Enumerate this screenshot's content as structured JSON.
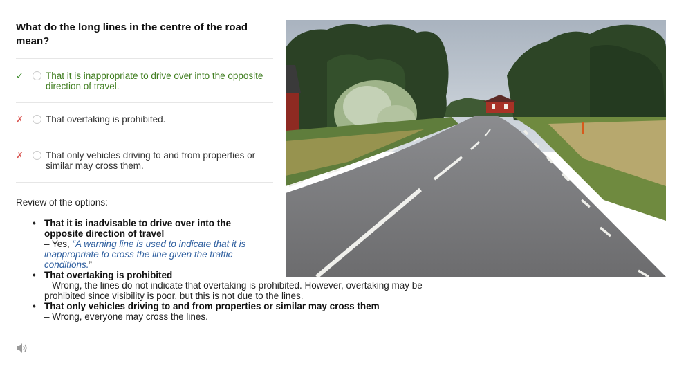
{
  "question": "What do the long lines in the centre of the road mean?",
  "options": [
    {
      "mark": "✓",
      "text": "That it is inappropriate to drive over into the opposite direction of travel."
    },
    {
      "mark": "✗",
      "text": "That overtaking is prohibited."
    },
    {
      "mark": "✗",
      "text": "That only vehicles driving to and from properties or similar may cross them."
    }
  ],
  "review": {
    "title": "Review of the options:",
    "items": [
      {
        "head": "That it is inadvisable to drive over into the opposite direction of travel",
        "prefix": "– Yes, ",
        "quote": "“A warning line is used to indicate that it is inappropriate to cross the line given the traffic conditions.",
        "suffix": "”"
      },
      {
        "head": "That overtaking is prohibited",
        "body": "– Wrong, the lines do not indicate that overtaking is prohibited. However, overtaking may be prohibited since visibility is poor, but this is not due to the lines."
      },
      {
        "head": "That only vehicles driving to and from properties or similar may cross them",
        "body": "– Wrong, everyone may cross the lines."
      }
    ]
  },
  "icons": {
    "correct": "check-icon",
    "wrong": "cross-icon",
    "audio": "speaker-icon"
  },
  "colors": {
    "correct": "#3f7d1f",
    "wrong": "#d9534f",
    "quote": "#2f5f9f"
  }
}
